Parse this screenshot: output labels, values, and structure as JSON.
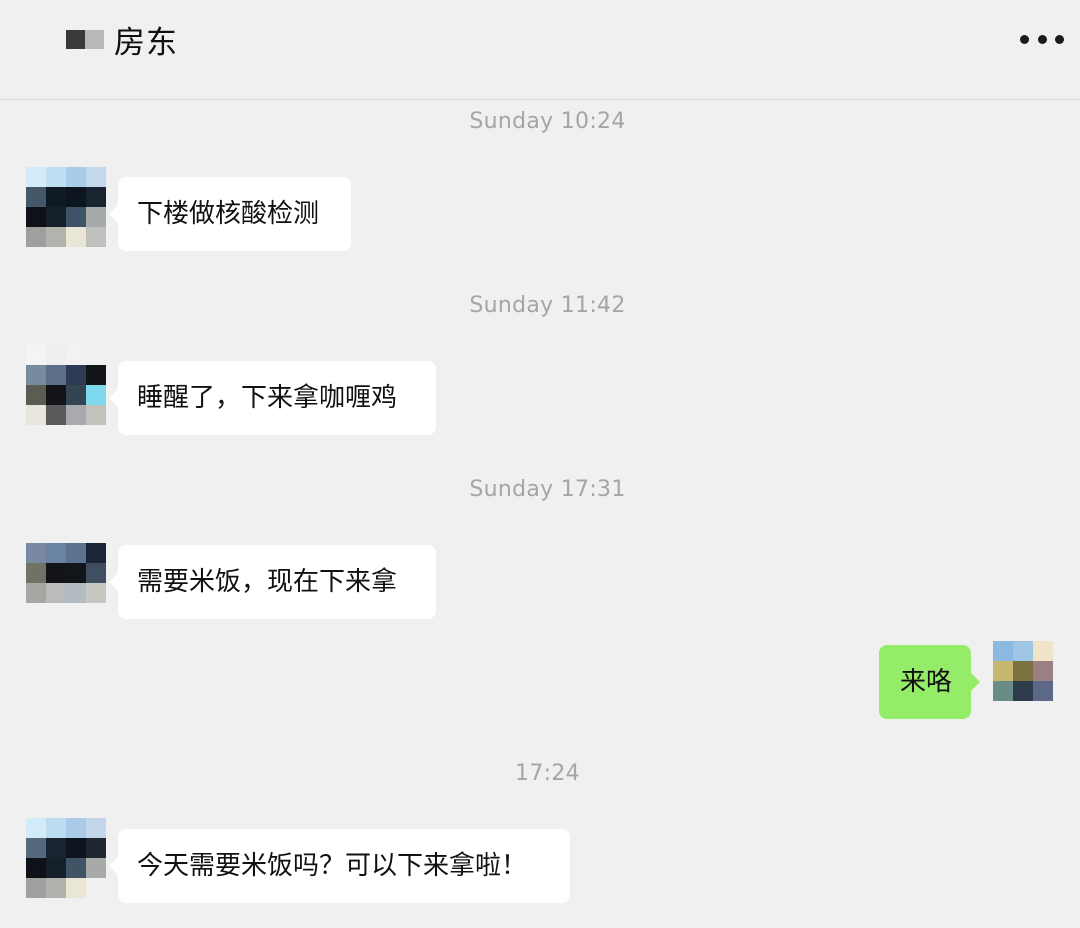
{
  "header": {
    "title": "房东",
    "more_icon": "more-horizontal-icon"
  },
  "messages": [
    {
      "timestamp": "Sunday 10:24",
      "sender": "contact",
      "text": "下楼做核酸检测"
    },
    {
      "timestamp": "Sunday 11:42",
      "sender": "contact",
      "text": "睡醒了，下来拿咖喱鸡"
    },
    {
      "timestamp": "Sunday 17:31",
      "sender": "contact",
      "text": "需要米饭，现在下来拿"
    },
    {
      "sender": "me",
      "text": "来咯"
    },
    {
      "timestamp": "17:24",
      "sender": "contact",
      "text": "今天需要米饭吗？可以下来拿啦！"
    }
  ],
  "colors": {
    "background": "#f0f0f0",
    "incoming_bubble": "#ffffff",
    "outgoing_bubble": "#95ec69",
    "timestamp_text": "#a5a5a5"
  }
}
